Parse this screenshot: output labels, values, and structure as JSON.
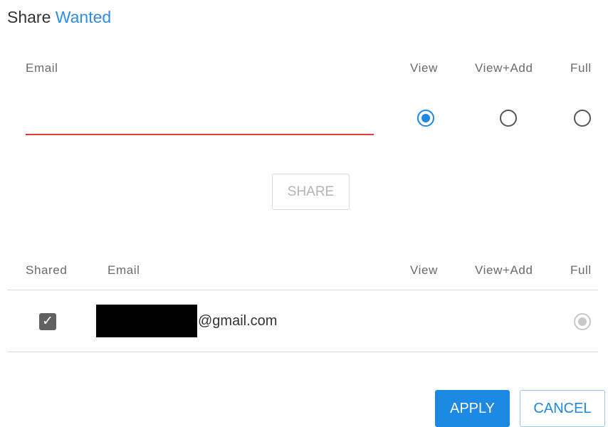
{
  "dialog": {
    "title_prefix": "Share",
    "title_accent": "Wanted"
  },
  "form": {
    "email_label": "Email",
    "email_value": "",
    "permissions": [
      {
        "label": "View",
        "checked": true
      },
      {
        "label": "View+Add",
        "checked": false
      },
      {
        "label": "Full",
        "checked": false
      }
    ],
    "share_label": "SHARE"
  },
  "table": {
    "headers": [
      "Shared",
      "Email",
      "View",
      "View+Add",
      "Full"
    ],
    "rows": [
      {
        "shared": true,
        "email": "@gmail.com",
        "email_redacted": true,
        "permission": "Full"
      }
    ]
  },
  "actions": {
    "apply_label": "APPLY",
    "cancel_label": "CANCEL"
  },
  "colors": {
    "accent": "#1e88e5",
    "error_underline": "#e53935",
    "disabled": "#c8c8c8"
  }
}
